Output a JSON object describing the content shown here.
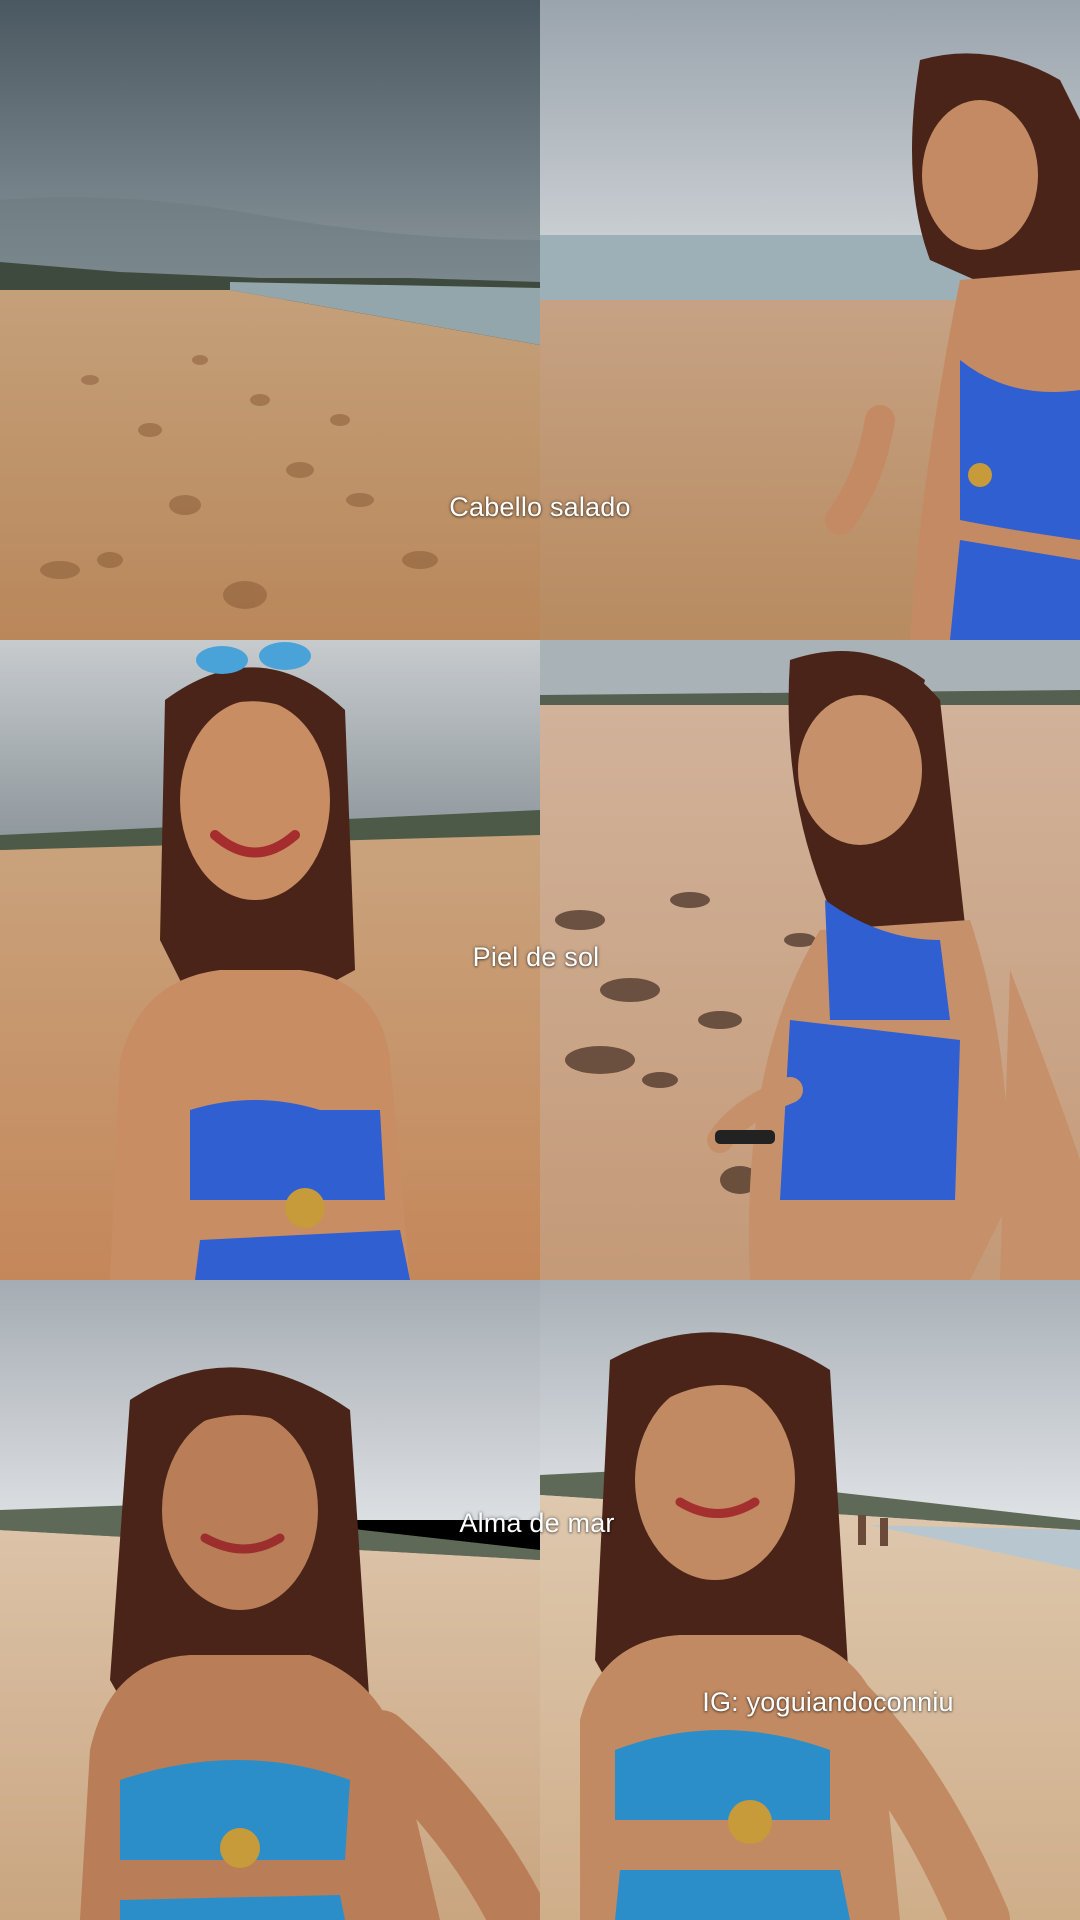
{
  "captions": {
    "row1": "Cabello salado",
    "row2": "Piel de sol",
    "row3": "Alma de mar",
    "handle": "IG: yoguiandoconniu"
  },
  "panels": [
    {
      "id": "beach-footprints",
      "description_icon": "beach-scene-icon"
    },
    {
      "id": "woman-walking-shore",
      "description_icon": "person-photo-icon"
    },
    {
      "id": "woman-smiling-sunglasses",
      "description_icon": "person-photo-icon"
    },
    {
      "id": "woman-selfie-stick-water",
      "description_icon": "person-photo-icon"
    },
    {
      "id": "woman-selfie-dunes",
      "description_icon": "person-photo-icon"
    },
    {
      "id": "woman-selfie-beach-people",
      "description_icon": "person-photo-icon"
    }
  ],
  "colors": {
    "sky": "#7e8a92",
    "sand": "#c99a6a",
    "sea": "#8fa3ad",
    "swimsuit": "#2f5fd0",
    "hair": "#4a2418"
  }
}
